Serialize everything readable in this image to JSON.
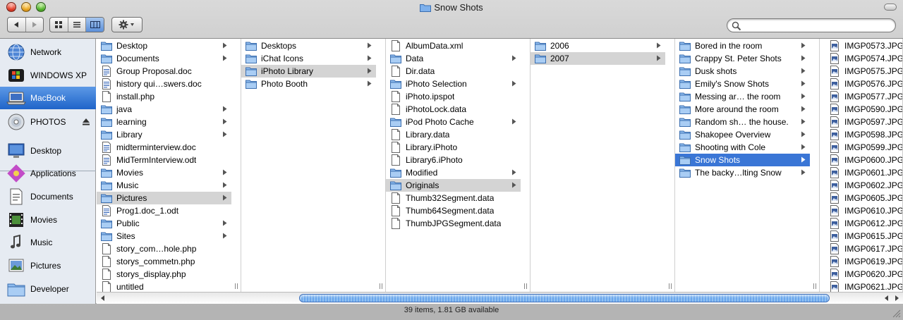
{
  "window": {
    "title": "Snow Shots"
  },
  "sidebar": {
    "items": [
      {
        "label": "Network",
        "icon": "network-globe-icon"
      },
      {
        "label": "WINDOWS XP",
        "icon": "windows-drive-icon"
      },
      {
        "label": "MacBook",
        "icon": "laptop-icon",
        "selected": true
      },
      {
        "label": "PHOTOS",
        "icon": "cd-disc-icon",
        "eject": true
      },
      {
        "label": "Desktop",
        "icon": "desktop-icon"
      },
      {
        "label": "Applications",
        "icon": "applications-icon"
      },
      {
        "label": "Documents",
        "icon": "documents-icon"
      },
      {
        "label": "Movies",
        "icon": "film-icon"
      },
      {
        "label": "Music",
        "icon": "music-note-icon"
      },
      {
        "label": "Pictures",
        "icon": "pictures-icon"
      },
      {
        "label": "Developer",
        "icon": "developer-folder-icon"
      }
    ]
  },
  "columns": [
    {
      "items": [
        {
          "label": "Desktop",
          "icon": "folder",
          "arrow": true
        },
        {
          "label": "Documents",
          "icon": "folder",
          "arrow": true
        },
        {
          "label": "Group Proposal.doc",
          "icon": "doc"
        },
        {
          "label": "history qui…swers.doc",
          "icon": "doc"
        },
        {
          "label": "install.php",
          "icon": "file"
        },
        {
          "label": "java",
          "icon": "folder",
          "arrow": true
        },
        {
          "label": "learning",
          "icon": "folder",
          "arrow": true
        },
        {
          "label": "Library",
          "icon": "folder",
          "arrow": true
        },
        {
          "label": "midterminterview.doc",
          "icon": "doc"
        },
        {
          "label": "MidTermInterview.odt",
          "icon": "doc"
        },
        {
          "label": "Movies",
          "icon": "folder",
          "arrow": true
        },
        {
          "label": "Music",
          "icon": "folder",
          "arrow": true
        },
        {
          "label": "Pictures",
          "icon": "folder",
          "arrow": true,
          "selected": "inactive"
        },
        {
          "label": "Prog1.doc_1.odt",
          "icon": "doc"
        },
        {
          "label": "Public",
          "icon": "folder",
          "arrow": true
        },
        {
          "label": "Sites",
          "icon": "folder",
          "arrow": true
        },
        {
          "label": "story_com…hole.php",
          "icon": "file"
        },
        {
          "label": "storys_commetn.php",
          "icon": "file"
        },
        {
          "label": "storys_display.php",
          "icon": "file"
        },
        {
          "label": "untitled",
          "icon": "file"
        }
      ]
    },
    {
      "items": [
        {
          "label": "Desktops",
          "icon": "folder",
          "arrow": true
        },
        {
          "label": "iChat Icons",
          "icon": "folder",
          "arrow": true
        },
        {
          "label": "iPhoto Library",
          "icon": "folder",
          "arrow": true,
          "selected": "inactive"
        },
        {
          "label": "Photo Booth",
          "icon": "folder",
          "arrow": true
        }
      ]
    },
    {
      "items": [
        {
          "label": "AlbumData.xml",
          "icon": "file"
        },
        {
          "label": "Data",
          "icon": "folder",
          "arrow": true
        },
        {
          "label": "Dir.data",
          "icon": "file"
        },
        {
          "label": "iPhoto Selection",
          "icon": "folder",
          "arrow": true
        },
        {
          "label": "iPhoto.ipspot",
          "icon": "file"
        },
        {
          "label": "iPhotoLock.data",
          "icon": "file"
        },
        {
          "label": "iPod Photo Cache",
          "icon": "folder",
          "arrow": true
        },
        {
          "label": "Library.data",
          "icon": "file"
        },
        {
          "label": "Library.iPhoto",
          "icon": "file"
        },
        {
          "label": "Library6.iPhoto",
          "icon": "file"
        },
        {
          "label": "Modified",
          "icon": "folder",
          "arrow": true
        },
        {
          "label": "Originals",
          "icon": "folder",
          "arrow": true,
          "selected": "inactive"
        },
        {
          "label": "Thumb32Segment.data",
          "icon": "file"
        },
        {
          "label": "Thumb64Segment.data",
          "icon": "file"
        },
        {
          "label": "ThumbJPGSegment.data",
          "icon": "file"
        }
      ]
    },
    {
      "items": [
        {
          "label": "2006",
          "icon": "folder",
          "arrow": true
        },
        {
          "label": "2007",
          "icon": "folder",
          "arrow": true,
          "selected": "inactive"
        }
      ]
    },
    {
      "items": [
        {
          "label": "Bored in the room",
          "icon": "folder",
          "arrow": true
        },
        {
          "label": "Crappy St. Peter Shots",
          "icon": "folder",
          "arrow": true
        },
        {
          "label": "Dusk shots",
          "icon": "folder",
          "arrow": true
        },
        {
          "label": "Emily's Snow Shots",
          "icon": "folder",
          "arrow": true
        },
        {
          "label": "Messing ar… the room",
          "icon": "folder",
          "arrow": true
        },
        {
          "label": "More around the room",
          "icon": "folder",
          "arrow": true
        },
        {
          "label": "Random sh… the house.",
          "icon": "folder",
          "arrow": true
        },
        {
          "label": "Shakopee Overview",
          "icon": "folder",
          "arrow": true
        },
        {
          "label": "Shooting with Cole",
          "icon": "folder",
          "arrow": true
        },
        {
          "label": "Snow Shots",
          "icon": "folder",
          "arrow": true,
          "selected": "active"
        },
        {
          "label": "The backy…lting Snow",
          "icon": "folder",
          "arrow": true
        }
      ]
    },
    {
      "items": [
        {
          "label": "IMGP0573.JPG",
          "icon": "image"
        },
        {
          "label": "IMGP0574.JPG",
          "icon": "image"
        },
        {
          "label": "IMGP0575.JPG",
          "icon": "image"
        },
        {
          "label": "IMGP0576.JPG",
          "icon": "image"
        },
        {
          "label": "IMGP0577.JPG",
          "icon": "image"
        },
        {
          "label": "IMGP0590.JPG",
          "icon": "image"
        },
        {
          "label": "IMGP0597.JPG",
          "icon": "image"
        },
        {
          "label": "IMGP0598.JPG",
          "icon": "image"
        },
        {
          "label": "IMGP0599.JPG",
          "icon": "image"
        },
        {
          "label": "IMGP0600.JPG",
          "icon": "image"
        },
        {
          "label": "IMGP0601.JPG",
          "icon": "image"
        },
        {
          "label": "IMGP0602.JPG",
          "icon": "image"
        },
        {
          "label": "IMGP0605.JPG",
          "icon": "image"
        },
        {
          "label": "IMGP0610.JPG",
          "icon": "image"
        },
        {
          "label": "IMGP0612.JPG",
          "icon": "image"
        },
        {
          "label": "IMGP0615.JPG",
          "icon": "image"
        },
        {
          "label": "IMGP0617.JPG",
          "icon": "image"
        },
        {
          "label": "IMGP0619.JPG",
          "icon": "image"
        },
        {
          "label": "IMGP0620.JPG",
          "icon": "image"
        },
        {
          "label": "IMGP0621.JPG",
          "icon": "image"
        }
      ]
    }
  ],
  "status": {
    "text": "39 items, 1.81 GB available"
  },
  "colors": {
    "selection_active": "#3a76d6",
    "selection_inactive": "#d4d4d4",
    "folder": "#6fa6e6"
  }
}
